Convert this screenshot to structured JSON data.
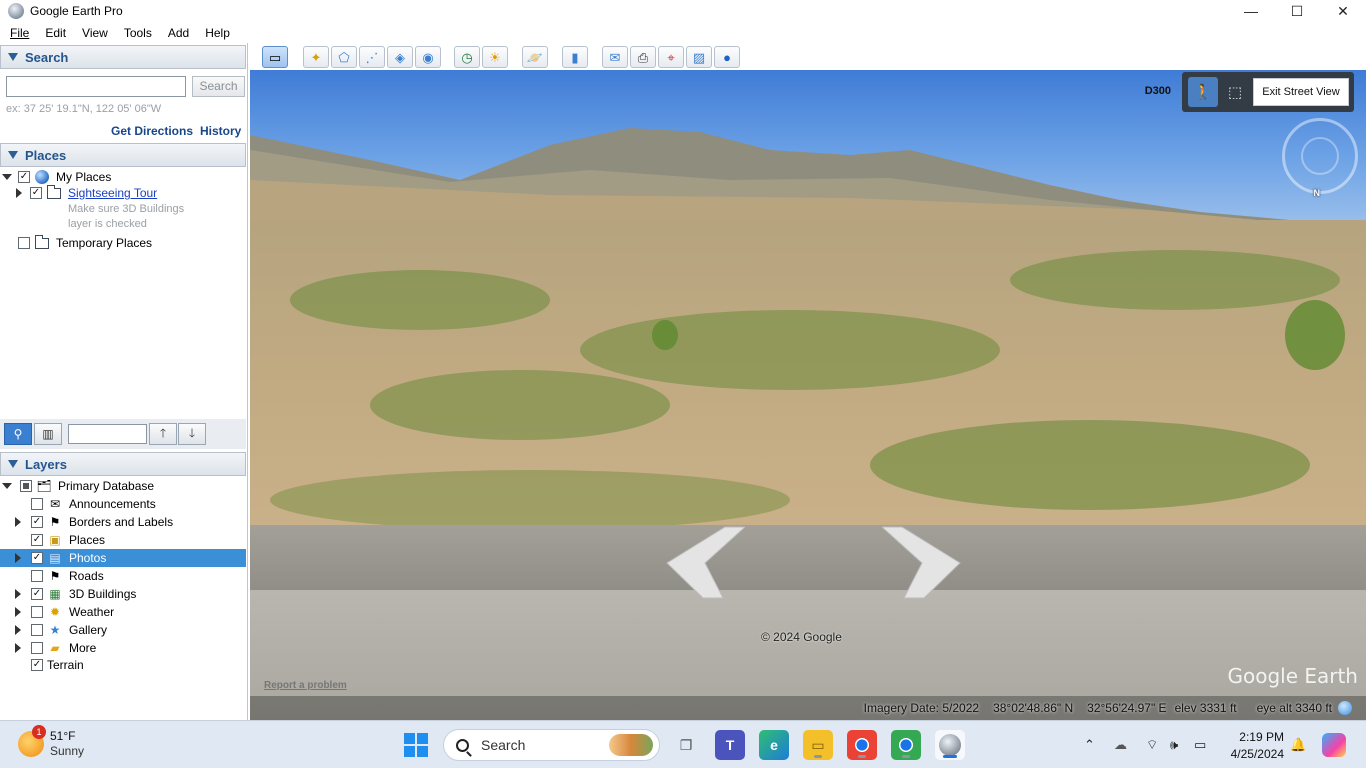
{
  "window": {
    "title": "Google Earth Pro"
  },
  "menu": [
    "File",
    "Edit",
    "View",
    "Tools",
    "Add",
    "Help"
  ],
  "search": {
    "header": "Search",
    "input_value": "",
    "button_label": "Search",
    "hint": "ex: 37 25' 19.1\"N, 122 05' 06\"W",
    "get_directions": "Get Directions",
    "history": "History"
  },
  "places": {
    "header": "Places",
    "my_places": "My Places",
    "sightseeing": "Sightseeing Tour",
    "note_line1": "Make sure 3D Buildings",
    "note_line2": "layer is checked",
    "temporary": "Temporary Places"
  },
  "layers": {
    "header": "Layers",
    "items": [
      {
        "label": "Primary Database",
        "state": "partial",
        "expander": "open"
      },
      {
        "label": "Announcements",
        "state": "unchecked",
        "expander": "none"
      },
      {
        "label": "Borders and Labels",
        "state": "checked",
        "expander": "closed"
      },
      {
        "label": "Places",
        "state": "checked",
        "expander": "none"
      },
      {
        "label": "Photos",
        "state": "checked",
        "expander": "closed",
        "selected": true
      },
      {
        "label": "Roads",
        "state": "unchecked",
        "expander": "none"
      },
      {
        "label": "3D Buildings",
        "state": "checked",
        "expander": "closed"
      },
      {
        "label": "Weather",
        "state": "unchecked",
        "expander": "closed"
      },
      {
        "label": "Gallery",
        "state": "unchecked",
        "expander": "closed"
      },
      {
        "label": "More",
        "state": "unchecked",
        "expander": "closed"
      },
      {
        "label": "Terrain",
        "state": "checked",
        "expander": "none"
      }
    ]
  },
  "viewport": {
    "camera_label": "D300",
    "exit_street_view": "Exit Street View",
    "compass_n": "N",
    "copyright": "© 2024 Google",
    "report": "Report a problem",
    "logo": "Google Earth",
    "imagery_date": "Imagery Date: 5/2022",
    "lat": "38°02'48.86\" N",
    "lon": "32°56'24.97\" E",
    "elev": "elev  3331 ft",
    "eye_alt": "eye alt  3340 ft"
  },
  "taskbar": {
    "weather_badge": "1",
    "temperature": "51°F",
    "condition": "Sunny",
    "search_label": "Search",
    "time": "2:19 PM",
    "date": "4/25/2024"
  },
  "colors": {
    "selection": "#3a8fd6",
    "section_header_text": "#24558d",
    "link": "#17468a"
  }
}
